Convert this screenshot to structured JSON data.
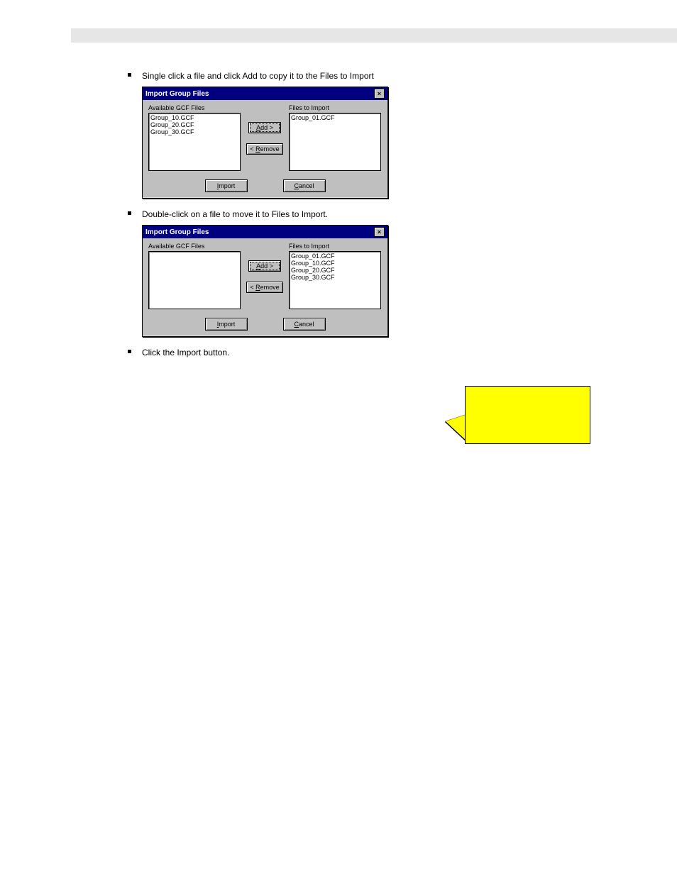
{
  "bullets": {
    "b1": "Single click a file and click Add to copy it to the Files to Import",
    "b2": "Double-click on a file to move it to Files to Import.",
    "b3": "Click the Import button."
  },
  "dialog1": {
    "title": "Import Group Files",
    "availableLabel": "Available GCF Files",
    "importLabel": "Files to Import",
    "available0": "Group_10.GCF",
    "available1": "Group_20.GCF",
    "available2": "Group_30.GCF",
    "import0": "Group_01.GCF",
    "addBtn": "Add >",
    "removeBtn": "< Remove",
    "importBtn": "Import",
    "cancelBtn": "Cancel"
  },
  "dialog2": {
    "title": "Import Group Files",
    "availableLabel": "Available GCF Files",
    "importLabel": "Files to Import",
    "import0": "Group_01.GCF",
    "import1": "Group_10.GCF",
    "import2": "Group_20.GCF",
    "import3": "Group_30.GCF",
    "addBtn": "Add >",
    "removeBtn": "< Remove",
    "importBtn": "Import",
    "cancelBtn": "Cancel"
  }
}
